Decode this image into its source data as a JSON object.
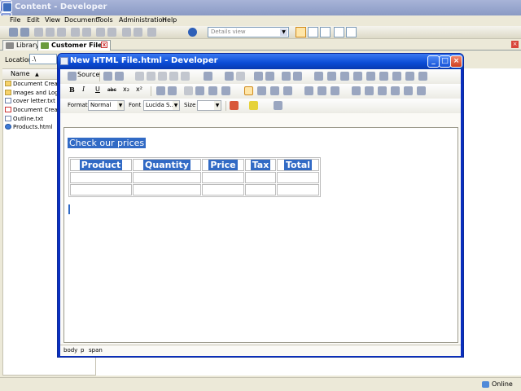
{
  "app": {
    "title": "Content - Developer",
    "menu": [
      "File",
      "Edit",
      "View",
      "Document",
      "Tools",
      "Administration",
      "Help"
    ],
    "view_selector": {
      "value": "Details view"
    }
  },
  "tabs": [
    {
      "label": "Library"
    },
    {
      "label": "Customer Files",
      "close": "x"
    }
  ],
  "location": {
    "label": "Location:",
    "value": ".\\"
  },
  "files": {
    "column": "Name",
    "items": [
      {
        "name": "Document Creation",
        "icon": "folder-icon"
      },
      {
        "name": "Images and Logos",
        "icon": "folder-icon"
      },
      {
        "name": "cover letter.txt",
        "icon": "text-file-icon"
      },
      {
        "name": "Document Creation",
        "icon": "document-icon"
      },
      {
        "name": "Outline.txt",
        "icon": "text-file-icon"
      },
      {
        "name": "Products.html",
        "icon": "web-page-icon"
      }
    ]
  },
  "editor": {
    "title": "New HTML File.html - Developer",
    "toolbar": {
      "source": "Source",
      "bold": "B",
      "italic": "I",
      "underline": "U",
      "strike": "abc",
      "subscript": "x₂",
      "superscript": "x²",
      "format_label": "Format",
      "format_value": "Normal",
      "font_label": "Font",
      "font_value": "Lucida S...",
      "size_label": "Size",
      "size_value": ""
    },
    "content": {
      "heading": "Check our prices",
      "table": {
        "headers": [
          "Product",
          "Quantity",
          "Price",
          "Tax",
          "Total"
        ],
        "rows": [
          [
            "",
            "",
            "",
            "",
            ""
          ],
          [
            "",
            "",
            "",
            "",
            ""
          ]
        ]
      }
    },
    "path": [
      "body",
      "p",
      "span"
    ]
  },
  "status": {
    "online": "Online"
  },
  "colors": {
    "selection": "#316ac5",
    "window_title": "#0a4bd5"
  }
}
